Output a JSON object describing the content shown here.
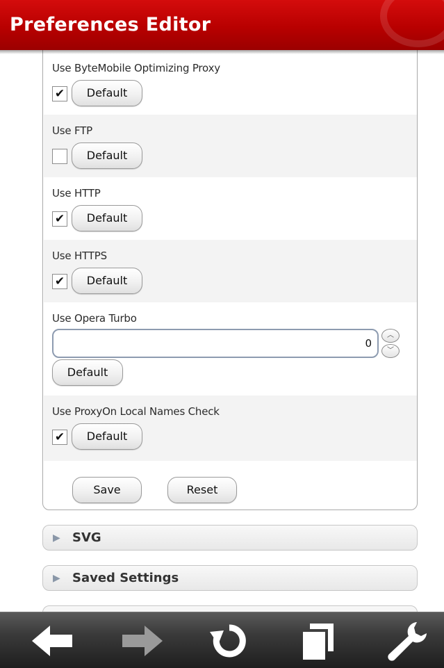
{
  "header": {
    "title": "Preferences Editor"
  },
  "prefs": [
    {
      "label": "Use ByteMobile Optimizing Proxy",
      "type": "checkbox",
      "checked": true,
      "default_label": "Default"
    },
    {
      "label": "Use FTP",
      "type": "checkbox",
      "checked": false,
      "default_label": "Default"
    },
    {
      "label": "Use HTTP",
      "type": "checkbox",
      "checked": true,
      "default_label": "Default"
    },
    {
      "label": "Use HTTPS",
      "type": "checkbox",
      "checked": true,
      "default_label": "Default"
    },
    {
      "label": "Use Opera Turbo",
      "type": "number",
      "value": "0",
      "default_label": "Default"
    },
    {
      "label": "Use ProxyOn Local Names Check",
      "type": "checkbox",
      "checked": true,
      "default_label": "Default"
    }
  ],
  "actions": {
    "save_label": "Save",
    "reset_label": "Reset"
  },
  "sections": [
    {
      "title": "SVG",
      "expanded": false
    },
    {
      "title": "Saved Settings",
      "expanded": false
    }
  ],
  "toolbar": {
    "icons": [
      "back-arrow-icon",
      "forward-arrow-icon",
      "reload-icon",
      "tabs-icon",
      "wrench-icon"
    ],
    "forward_enabled": false
  },
  "colors": {
    "header_red": "#c00000",
    "toolbar_dark": "#2e2e2e"
  }
}
